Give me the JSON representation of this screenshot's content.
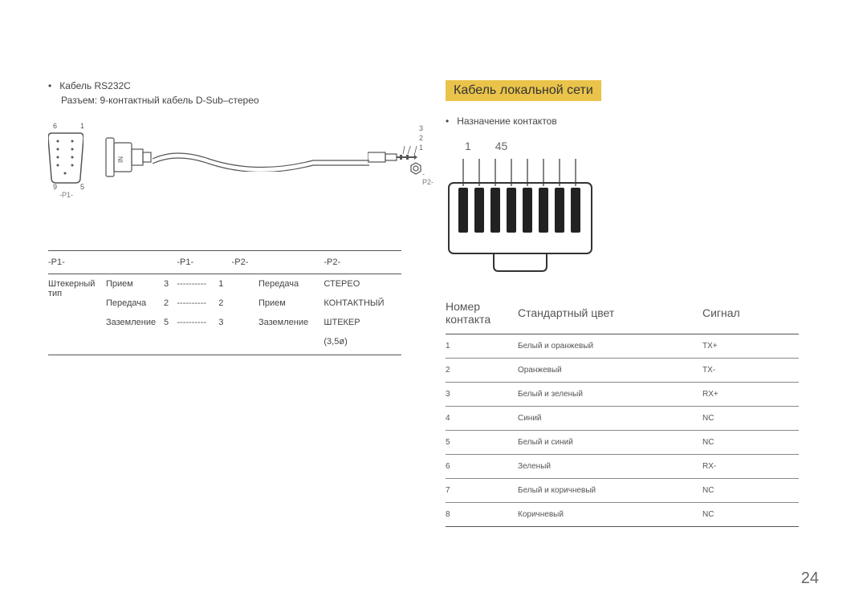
{
  "pageNumber": "24",
  "left": {
    "bullet": "Кабель RS232C",
    "sub": "Разъем: 9-контактный кабель D-Sub–стерео",
    "diagram": {
      "dsub_top_left": "6",
      "dsub_top_right": "1",
      "dsub_bot_left": "9",
      "dsub_bot_right": "5",
      "p1": "-P1-",
      "p2": "-P2-",
      "plug_labels": [
        "3",
        "2",
        "1"
      ]
    },
    "table": {
      "headers": [
        "-P1-",
        "",
        "",
        "-P1-",
        "",
        "-P2-",
        "",
        "-P2-"
      ],
      "rowhead": "Штекерный тип",
      "rows": [
        [
          "Прием",
          "3",
          "----------",
          "1",
          "",
          "Передача",
          "СТЕРЕО"
        ],
        [
          "Передача",
          "2",
          "----------",
          "2",
          "",
          "Прием",
          "КОНТАКТНЫЙ"
        ],
        [
          "Заземление",
          "5",
          "----------",
          "3",
          "",
          "Заземление",
          "ШТЕКЕР"
        ],
        [
          "",
          "",
          "",
          "",
          "",
          "",
          "(3,5ø)"
        ]
      ]
    }
  },
  "right": {
    "title": "Кабель локальной сети",
    "bullet": "Назначение контактов",
    "rj45": {
      "label1": "1",
      "label45": "45"
    },
    "table": {
      "headers": [
        "Номер контакта",
        "Стандартный цвет",
        "Сигнал"
      ],
      "rows": [
        [
          "1",
          "Белый и оранжевый",
          "TX+"
        ],
        [
          "2",
          "Оранжевый",
          "TX-"
        ],
        [
          "3",
          "Белый и зеленый",
          "RX+"
        ],
        [
          "4",
          "Синий",
          "NC"
        ],
        [
          "5",
          "Белый и синий",
          "NC"
        ],
        [
          "6",
          "Зеленый",
          "RX-"
        ],
        [
          "7",
          "Белый и коричневый",
          "NC"
        ],
        [
          "8",
          "Коричневый",
          "NC"
        ]
      ]
    }
  }
}
